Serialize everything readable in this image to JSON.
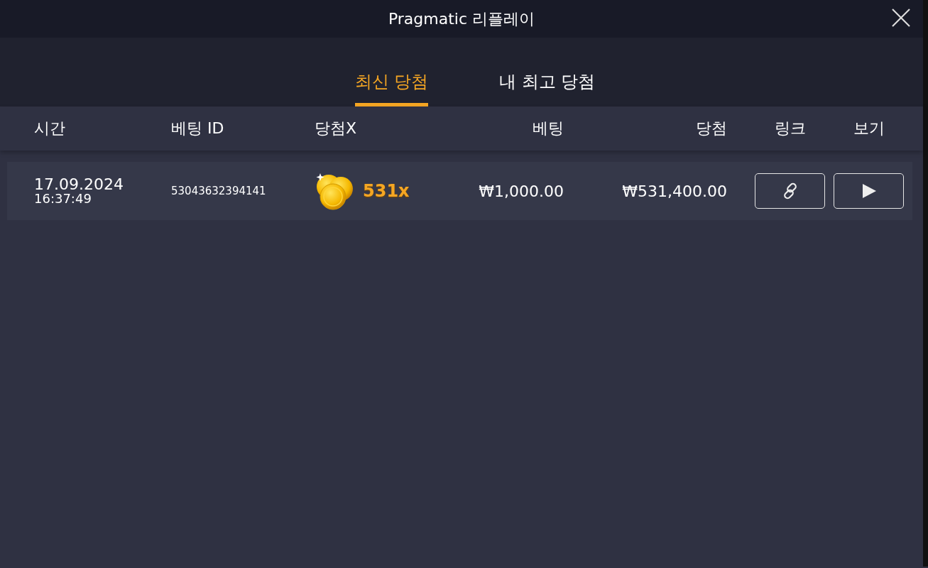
{
  "window": {
    "title": "Pragmatic 리플레이"
  },
  "tabs": [
    {
      "label": "최신 당첨",
      "selected": true
    },
    {
      "label": "내 최고 당첨",
      "selected": false
    }
  ],
  "table": {
    "columns": [
      "시간",
      "베팅 ID",
      "당첨X",
      "베팅",
      "당첨",
      "링크",
      "보기"
    ],
    "rows": [
      {
        "date": "17.09.2024",
        "time": "16:37:49",
        "bet_id": "53043632394141",
        "multiplier": "531x",
        "bet": "₩1,000.00",
        "win": "₩531,400.00"
      }
    ]
  }
}
